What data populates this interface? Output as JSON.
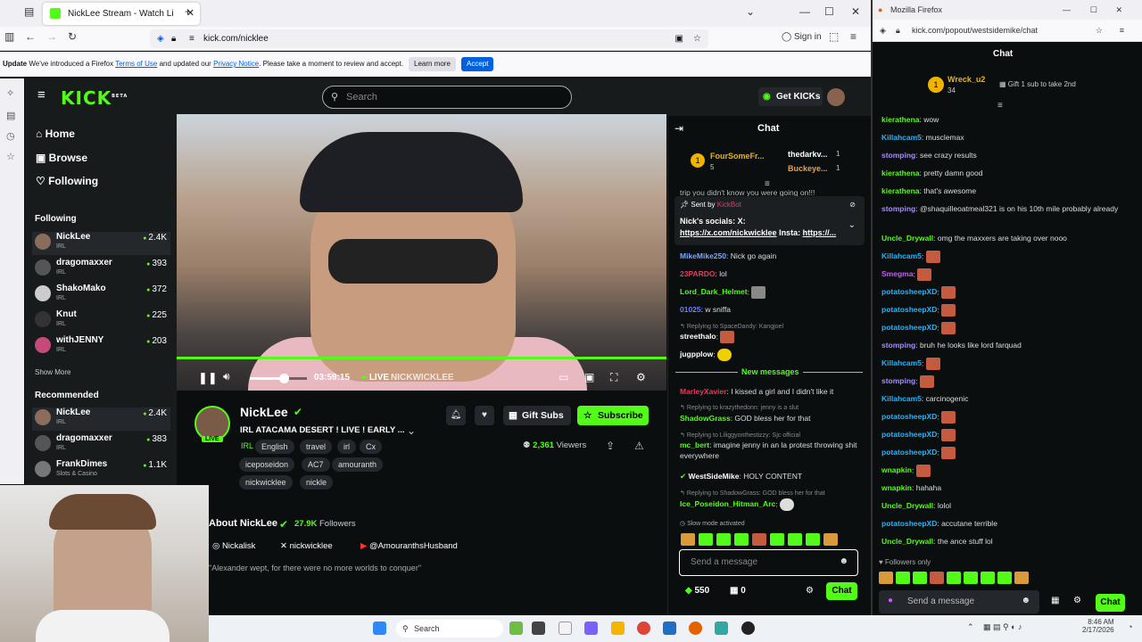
{
  "left_browser": {
    "tab_title": "NickLee Stream - Watch Li",
    "url": "kick.com/nicklee",
    "sign_in": "Sign in",
    "notice": {
      "update": "Update",
      "text1": "We've introduced a Firefox",
      "link1": "Terms of Use",
      "text2": "and updated our",
      "link2": "Privacy Notice",
      "text3": ". Please take a moment to review and accept.",
      "learn_more": "Learn more",
      "accept": "Accept"
    }
  },
  "kick": {
    "logo": "KICK",
    "beta": "BETA",
    "search_placeholder": "Search",
    "get_kicks": "Get KICKs",
    "nav": [
      "Home",
      "Browse",
      "Following"
    ],
    "following_title": "Following",
    "following": [
      {
        "name": "NickLee",
        "category": "IRL",
        "viewers": "2.4K"
      },
      {
        "name": "dragomaxxer",
        "category": "IRL",
        "viewers": "393"
      },
      {
        "name": "ShakoMako",
        "category": "IRL",
        "viewers": "372"
      },
      {
        "name": "Knut",
        "category": "IRL",
        "viewers": "225"
      },
      {
        "name": "withJENNY",
        "category": "IRL",
        "viewers": "203"
      }
    ],
    "show_more": "Show More",
    "recommended_title": "Recommended",
    "recommended": [
      {
        "name": "NickLee",
        "category": "IRL",
        "viewers": "2.4K"
      },
      {
        "name": "dragomaxxer",
        "category": "IRL",
        "viewers": "383"
      },
      {
        "name": "FrankDimes",
        "category": "Slots & Casino",
        "viewers": "1.1K"
      }
    ]
  },
  "player": {
    "time": "03:59:15",
    "live": "LIVE",
    "watermark": "NICKWICKLEE",
    "volume_level": 0.6,
    "progress": 1.0
  },
  "stream": {
    "streamer": "NickLee",
    "live_badge": "LIVE",
    "title": "IRL ATACAMA DESERT ! LIVE ! EARLY ...",
    "category": "IRL",
    "tags_row1": [
      "English",
      "travel",
      "irl",
      "Cx"
    ],
    "tags_row2": [
      "iceposeidon",
      "AC7",
      "amouranth"
    ],
    "tags_row3": [
      "nickwicklee",
      "nickle"
    ],
    "gift_subs": "Gift Subs",
    "subscribe": "Subscribe",
    "viewers": "2,361",
    "viewers_label": "Viewers",
    "about_title": "About NickLee",
    "followers_count": "27.9K",
    "followers_label": "Followers",
    "socials": [
      "Nickalisk",
      "nickwicklee",
      "@AmouranthsHusband"
    ],
    "quote": "\"Alexander wept, for there were no more worlds to conquer\""
  },
  "chat": {
    "title": "Chat",
    "leader1": {
      "name": "FourSomeFr...",
      "count": "5"
    },
    "leader2": {
      "name": "thedarkv...",
      "count": "1"
    },
    "leader3": {
      "name": "Buckeye...",
      "count": "1"
    },
    "partial_line": "trip you didn't know you were going on!!!",
    "pinned_by_label": "Sent by",
    "pinned_by": "KickBot",
    "pinned_text": "Nick's socials: X:",
    "pinned_link1": "https://x.com/nickwicklee",
    "pinned_insta": "Insta:",
    "pinned_link2": "https://...",
    "messages_top": [
      {
        "user": "MikeMike250",
        "text": "Nick go again",
        "color": "#7ea6ff"
      },
      {
        "user": "23PARDO",
        "text": "lol",
        "color": "#e33d5c"
      },
      {
        "user": "Lord_Dark_Helmet",
        "text": "",
        "color": "#53fc18"
      },
      {
        "user": "01025",
        "text": "w sniffa",
        "color": "#6c7dff"
      }
    ],
    "reply1": "Replying to SpaceDandy: Kangjoel",
    "streethalo": "streethalo",
    "jugpplow": "jugpplow",
    "new_messages": "New messages",
    "marley": {
      "user": "MarleyXavier",
      "text": "I kissed a girl and I didn't like it"
    },
    "reply2": "Replying to krazythedonn: jenny is a slut",
    "shadow": {
      "user": "ShadowGrass",
      "text": "GOD bless her for that"
    },
    "reply3": "Replying to Liliggyonthestizzy: Sjc official",
    "mc": {
      "user": "mc_bert",
      "text": "imagine jenny in an la protest throwing shit everywhere"
    },
    "westside": {
      "user": "WestSideMike",
      "text": "HOLY CONTENT"
    },
    "reply4": "Replying to ShadowGrass: GOD bless her for that",
    "ice": {
      "user": "Ice_Poseidon_Hitman_Arc",
      "text": ""
    },
    "slow_mode": "Slow mode activated",
    "input_placeholder": "Send a message",
    "kicks_count": "550",
    "gift_count": "0",
    "chat_button": "Chat"
  },
  "right_browser": {
    "title": "Mozilla Firefox",
    "url": "kick.com/popout/westsidemike/chat",
    "chat_title": "Chat",
    "leader": {
      "name": "Wreck_u2",
      "count": "34"
    },
    "gift_prompt": "Gift 1 sub to take 2nd",
    "messages": [
      {
        "user": "kierathena",
        "text": "wow",
        "color": "#53fc18"
      },
      {
        "user": "Killahcam5",
        "text": "musclemax",
        "color": "#1fb6ff"
      },
      {
        "user": "stomping",
        "text": "see crazy results",
        "color": "#a78bff"
      },
      {
        "user": "kierathena",
        "text": "pretty damn good",
        "color": "#53fc18"
      },
      {
        "user": "kierathena",
        "text": "that's awesome",
        "color": "#53fc18"
      },
      {
        "user": "stomping",
        "text": "@shaquilleoatmeal321 is on his 10th mile probably already",
        "color": "#a78bff"
      },
      {
        "user": "Uncle_Drywall",
        "text": "omg the maxxers are taking over nooo",
        "color": "#53fc18"
      },
      {
        "user": "Killahcam5",
        "text": "",
        "color": "#1fb6ff"
      },
      {
        "user": "Smegma",
        "text": "",
        "color": "#c45bff"
      },
      {
        "user": "potatosheepXD",
        "text": "",
        "color": "#1fb6ff"
      },
      {
        "user": "potatosheepXD",
        "text": "",
        "color": "#1fb6ff"
      },
      {
        "user": "potatosheepXD",
        "text": "",
        "color": "#1fb6ff"
      },
      {
        "user": "stomping",
        "text": "bruh he looks like lord farquad",
        "color": "#a78bff"
      },
      {
        "user": "Killahcam5",
        "text": "",
        "color": "#1fb6ff"
      },
      {
        "user": "stomping",
        "text": "",
        "color": "#a78bff"
      },
      {
        "user": "Killahcam5",
        "text": "carcinogenic",
        "color": "#1fb6ff"
      },
      {
        "user": "potatosheepXD",
        "text": "",
        "color": "#1fb6ff"
      },
      {
        "user": "potatosheepXD",
        "text": "",
        "color": "#1fb6ff"
      },
      {
        "user": "potatosheepXD",
        "text": "",
        "color": "#1fb6ff"
      },
      {
        "user": "wnapkin",
        "text": "",
        "color": "#53fc18"
      },
      {
        "user": "wnapkin",
        "text": "hahaha",
        "color": "#53fc18"
      },
      {
        "user": "Uncle_Drywall",
        "text": "lolol",
        "color": "#53fc18"
      },
      {
        "user": "potatosheepXD",
        "text": "accutane terrible",
        "color": "#1fb6ff"
      },
      {
        "user": "Uncle_Drywall",
        "text": "the ance stuff lol",
        "color": "#53fc18"
      }
    ],
    "followers_only": "Followers only",
    "input_placeholder": "Send a message",
    "chat_button": "Chat"
  },
  "taskbar": {
    "search": "Search",
    "time": "8:46 AM",
    "date": "2/17/2026"
  },
  "colors": {
    "kick_green": "#53fc18",
    "firefox_blue": "#0060df"
  }
}
